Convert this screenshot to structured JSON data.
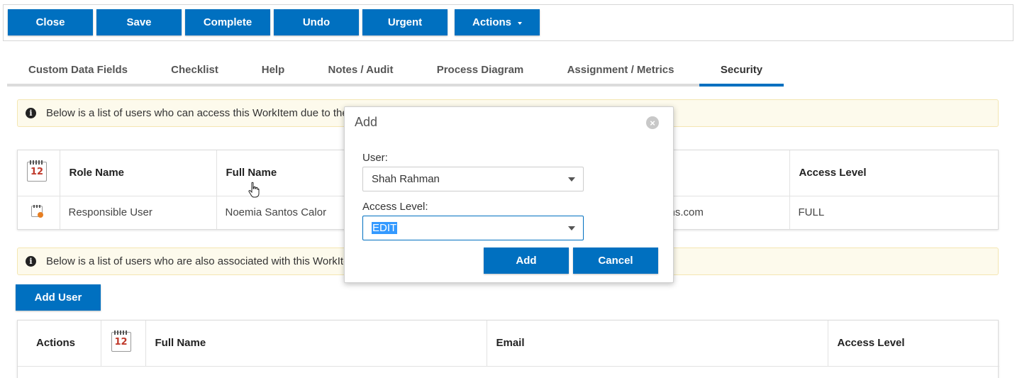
{
  "toolbar": {
    "buttons": [
      "Close",
      "Save",
      "Complete",
      "Undo",
      "Urgent"
    ],
    "actions_label": "Actions"
  },
  "tabs": [
    "Custom Data Fields",
    "Checklist",
    "Help",
    "Notes / Audit",
    "Process Diagram",
    "Assignment / Metrics",
    "Security"
  ],
  "active_tab": "Security",
  "notice1": "Below is a list of users who can access this WorkItem due to the",
  "roles_table": {
    "calendar_icon_text": "12",
    "headers": [
      "Role Name",
      "Full Name",
      "Access Level"
    ],
    "rows": [
      {
        "role": "Responsible User",
        "full_name": "Noemia Santos Calor",
        "email_partial": "ns.com",
        "access": "FULL"
      }
    ]
  },
  "notice2": "Below is a list of users who are also associated with this WorkIte",
  "add_user_label": "Add User",
  "users_table": {
    "calendar_icon_text": "12",
    "headers": [
      "Actions",
      "Full Name",
      "Email",
      "Access Level"
    ]
  },
  "modal": {
    "title": "Add",
    "close_glyph": "×",
    "user_label": "User:",
    "user_value": "Shah Rahman",
    "access_label": "Access Level:",
    "access_value": "EDIT",
    "add_label": "Add",
    "cancel_label": "Cancel"
  },
  "colors": {
    "primary": "#0070c0",
    "notice_bg": "#fdfaec",
    "selection": "#3399ff"
  }
}
